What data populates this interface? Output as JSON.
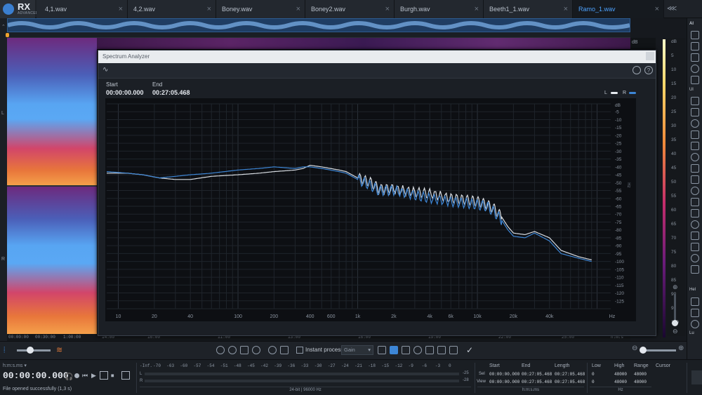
{
  "app": {
    "logo_text": "RX",
    "logo_sub": "ADVANCED"
  },
  "tabs": [
    {
      "label": ""
    },
    {
      "label": "4,1.wav"
    },
    {
      "label": "4,2.wav"
    },
    {
      "label": "Boney.wav"
    },
    {
      "label": "Boney2.wav"
    },
    {
      "label": "Burgh.wav"
    },
    {
      "label": "Beeth1_1.wav"
    },
    {
      "label": "Ramo_1.wav"
    }
  ],
  "channels": {
    "left": "L",
    "right": "R"
  },
  "spectrum_analyzer": {
    "title": "Spectrum Analyzer",
    "start_label": "Start",
    "start_value": "00:00:00.000",
    "end_label": "End",
    "end_value": "00:27:05.468",
    "legend": {
      "L": "L",
      "R": "R"
    },
    "unit_db": "dB",
    "unit_hz": "Hz"
  },
  "chart_data": {
    "type": "line",
    "title": "",
    "xlabel": "Hz",
    "ylabel": "dB",
    "x_scale": "log",
    "xlim": [
      8,
      130000
    ],
    "ylim": [
      -130,
      0
    ],
    "x_ticks": [
      "10",
      "20",
      "40",
      "100",
      "200",
      "400",
      "600",
      "1k",
      "2k",
      "4k",
      "6k",
      "10k",
      "20k",
      "40k",
      "Hz"
    ],
    "y_ticks": [
      "dB",
      "-5",
      "-10",
      "-15",
      "-20",
      "-25",
      "-30",
      "-35",
      "-40",
      "-45",
      "-50",
      "-55",
      "-60",
      "-65",
      "-70",
      "-75",
      "-80",
      "-85",
      "-90",
      "-95",
      "-100",
      "-105",
      "-110",
      "-115",
      "-120",
      "-125"
    ],
    "grid": true,
    "legend_position": "top-right",
    "series": [
      {
        "name": "L",
        "color": "#d8dde3",
        "points": [
          [
            8,
            -44
          ],
          [
            12,
            -44
          ],
          [
            16,
            -45
          ],
          [
            22,
            -47
          ],
          [
            30,
            -48
          ],
          [
            40,
            -48
          ],
          [
            60,
            -46
          ],
          [
            100,
            -45
          ],
          [
            150,
            -44
          ],
          [
            200,
            -43
          ],
          [
            300,
            -42
          ],
          [
            350,
            -41
          ],
          [
            400,
            -39
          ],
          [
            500,
            -40
          ],
          [
            700,
            -42
          ],
          [
            800,
            -43
          ],
          [
            1000,
            -47
          ],
          [
            1300,
            -50
          ],
          [
            1500,
            -54
          ],
          [
            2000,
            -54
          ],
          [
            3000,
            -56
          ],
          [
            4000,
            -57
          ],
          [
            6000,
            -60
          ],
          [
            8000,
            -61
          ],
          [
            10000,
            -62
          ],
          [
            12000,
            -64
          ],
          [
            14000,
            -67
          ],
          [
            16000,
            -72
          ],
          [
            18000,
            -78
          ],
          [
            20000,
            -82
          ],
          [
            25000,
            -83
          ],
          [
            30000,
            -81
          ],
          [
            40000,
            -85
          ],
          [
            50000,
            -93
          ],
          [
            70000,
            -97
          ],
          [
            90000,
            -99
          ]
        ]
      },
      {
        "name": "R",
        "color": "#3d86d6",
        "points": [
          [
            8,
            -43
          ],
          [
            12,
            -44
          ],
          [
            16,
            -45
          ],
          [
            22,
            -47
          ],
          [
            30,
            -46
          ],
          [
            40,
            -45
          ],
          [
            60,
            -44
          ],
          [
            100,
            -42
          ],
          [
            150,
            -41
          ],
          [
            200,
            -40
          ],
          [
            300,
            -41
          ],
          [
            350,
            -40
          ],
          [
            400,
            -40
          ],
          [
            500,
            -41
          ],
          [
            700,
            -43
          ],
          [
            800,
            -44
          ],
          [
            1000,
            -48
          ],
          [
            1300,
            -52
          ],
          [
            1500,
            -55
          ],
          [
            2000,
            -55
          ],
          [
            3000,
            -58
          ],
          [
            4000,
            -60
          ],
          [
            6000,
            -62
          ],
          [
            8000,
            -63
          ],
          [
            10000,
            -64
          ],
          [
            12000,
            -65
          ],
          [
            14000,
            -69
          ],
          [
            16000,
            -74
          ],
          [
            18000,
            -80
          ],
          [
            20000,
            -84
          ],
          [
            25000,
            -85
          ],
          [
            30000,
            -82
          ],
          [
            40000,
            -87
          ],
          [
            50000,
            -95
          ],
          [
            70000,
            -98
          ],
          [
            90000,
            -100
          ]
        ]
      }
    ]
  },
  "spectrogram": {
    "time_labels": [
      "00:00:00",
      "00:30:00",
      "1:00:00",
      "1:30:00",
      "2:00:00",
      "3:00:00"
    ],
    "bottom_time_labels": [
      "h:m:s",
      "14:00",
      "15:00",
      "16:00",
      "17:00",
      "18:00",
      "19:00",
      "10:00",
      "11:00",
      "12:00",
      "13:00",
      "14:00",
      "15:00",
      "16:00",
      "17:00",
      "18:00",
      "19:00",
      "20:00",
      "21:00",
      "22:00",
      "23:00",
      "24:00",
      "25:00",
      "26:00",
      "h:m:s"
    ],
    "db_scale": [
      "dB",
      "5",
      "10",
      "15",
      "20",
      "25",
      "30",
      "35",
      "40",
      "45",
      "50",
      "55",
      "60",
      "65",
      "70",
      "75",
      "80",
      "85",
      "90",
      "95",
      "100"
    ],
    "db_scale_right": [
      "dB",
      "-5",
      "-10",
      "-15",
      "-20",
      "-25",
      "-30",
      "-35",
      "-40",
      "-45",
      "-50",
      "-55",
      "-60",
      "-65",
      "-70",
      "-75",
      "-80",
      "-85",
      "-90",
      "-95",
      "-100",
      "-105",
      "-110",
      "-115",
      "-120",
      "-125"
    ]
  },
  "bottom_toolbar": {
    "instant_process_label": "Instant process",
    "gain_select": "Gain"
  },
  "status": {
    "time_format": "h:m:s.ms ▾",
    "time_value": "00:00:00.000",
    "message": "File opened successfully (1,3 s)",
    "meter_scale": [
      "-Inf.",
      "-70",
      "-63",
      "-60",
      "-57",
      "-54",
      "-51",
      "-48",
      "-45",
      "-42",
      "-39",
      "-36",
      "-33",
      "-30",
      "-27",
      "-24",
      "-21",
      "-18",
      "-15",
      "-12",
      "-9",
      "-6",
      "-3",
      "0"
    ],
    "meter_L_peak": "-25",
    "meter_R_peak": "-28",
    "format": "24-bit | 96000 Hz",
    "sel_label": "Sel",
    "view_label": "View",
    "start_header": "Start",
    "end_header": "End",
    "length_header": "Length",
    "sel_start": "00:00:00.000",
    "sel_end": "00:27:05.468",
    "sel_length": "00:27:05.468",
    "view_start": "00:00:00.000",
    "view_end": "00:27:05.468",
    "view_length": "00:27:05.468",
    "time_unit": "h:m:s.ms",
    "low_header": "Low",
    "high_header": "High",
    "range_header": "Range",
    "cursor_header": "Cursor",
    "sel_low": "0",
    "sel_high": "48000",
    "sel_range": "48000",
    "view_low": "0",
    "view_high": "48000",
    "view_range": "48000",
    "freq_unit": "Hz"
  },
  "right_toolbar": {
    "labels": [
      "Al",
      "Hel",
      "Lu",
      "Ul"
    ]
  }
}
